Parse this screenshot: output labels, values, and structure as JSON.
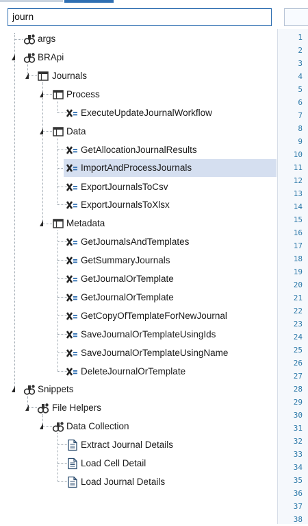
{
  "search": {
    "value": "journ"
  },
  "tree": {
    "args": "args",
    "brapi": "BRApi",
    "journals": "Journals",
    "process": "Process",
    "execute_update": "ExecuteUpdateJournalWorkflow",
    "data": "Data",
    "get_allocation": "GetAllocationJournalResults",
    "import_process": "ImportAndProcessJournals",
    "export_csv": "ExportJournalsToCsv",
    "export_xlsx": "ExportJournalsToXlsx",
    "metadata": "Metadata",
    "get_journals_templates": "GetJournalsAndTemplates",
    "get_summary": "GetSummaryJournals",
    "get_journal_template_1": "GetJournalOrTemplate",
    "get_journal_template_2": "GetJournalOrTemplate",
    "get_copy_template": "GetCopyOfTemplateForNewJournal",
    "save_using_ids": "SaveJournalOrTemplateUsingIds",
    "save_using_name": "SaveJournalOrTemplateUsingName",
    "delete_journal": "DeleteJournalOrTemplate",
    "snippets": "Snippets",
    "file_helpers": "File Helpers",
    "data_collection": "Data Collection",
    "extract_journal": "Extract Journal Details",
    "load_cell": "Load Cell Detail",
    "load_journal": "Load Journal Details"
  },
  "editor": {
    "line_numbers": [
      "1",
      "2",
      "3",
      "4",
      "5",
      "6",
      "7",
      "8",
      "9",
      "10",
      "11",
      "12",
      "13",
      "14",
      "15",
      "16",
      "17",
      "18",
      "19",
      "20",
      "21",
      "22",
      "23",
      "24",
      "25",
      "26",
      "27",
      "28",
      "29",
      "30",
      "31",
      "32",
      "33",
      "34",
      "35",
      "36",
      "37",
      "38"
    ]
  },
  "colors": {
    "selection": "#d5dff0",
    "search_border": "#2b6cb0",
    "line_number": "#2b78a8"
  }
}
